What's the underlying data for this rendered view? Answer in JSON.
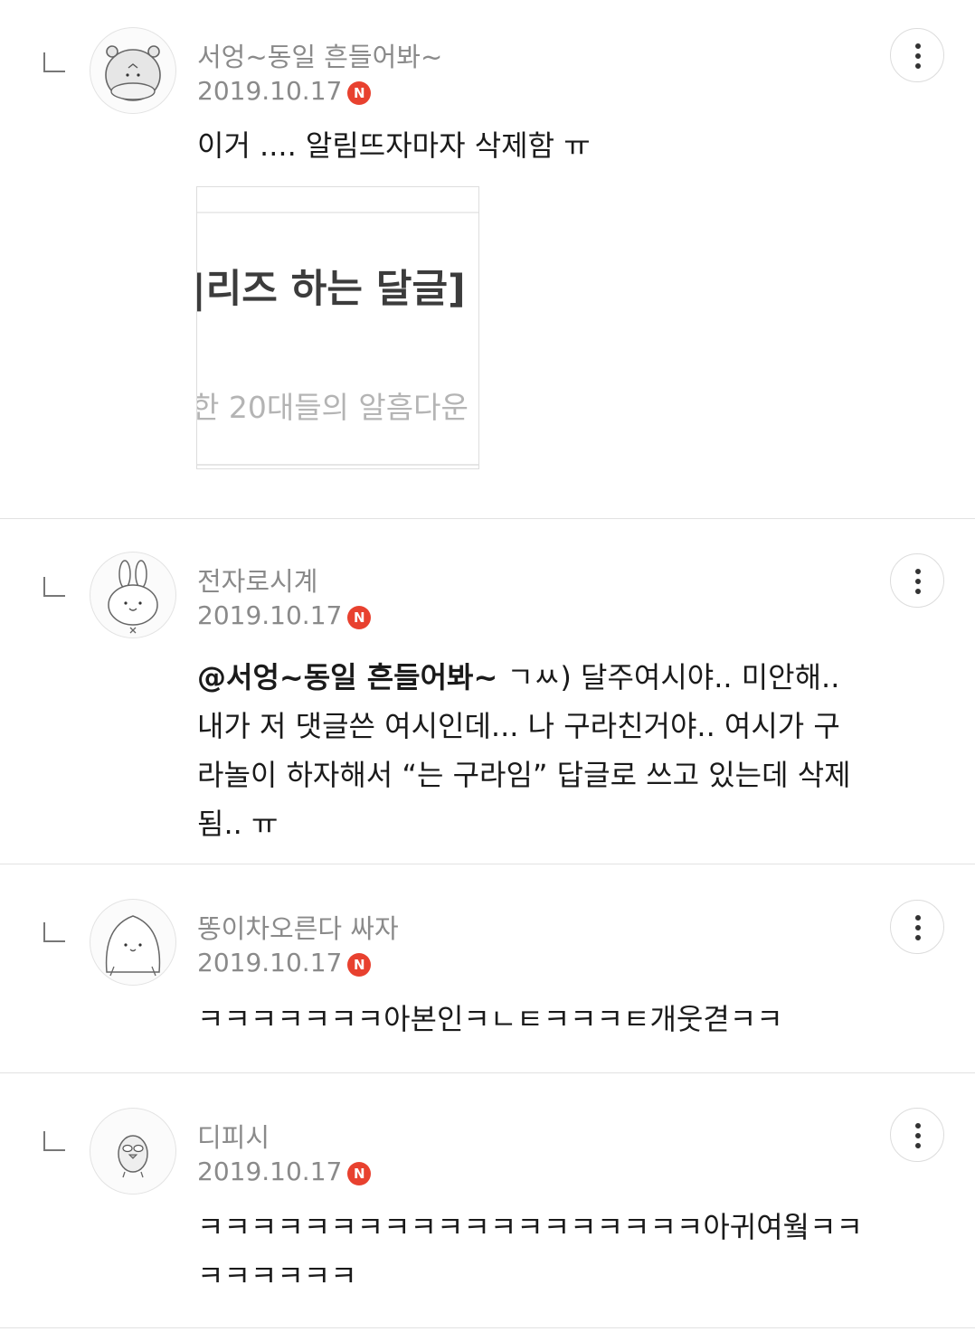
{
  "comments": [
    {
      "nickname": "서엉~동일 흔들어봐~",
      "date": "2019.10.17",
      "badge": "N",
      "mention": "",
      "text": "이거 .... 알림뜨자마자 삭제함 ㅠ",
      "avatar_icon": "hamster-avatar-icon",
      "image": {
        "title": "|리즈 하는 달글]",
        "subtitle": "한 20대들의 알흠다운"
      }
    },
    {
      "nickname": "전자로시계",
      "date": "2019.10.17",
      "badge": "N",
      "mention": "@서엉~동일 흔들어봐~",
      "text": " ㄱㅆ) 달주여시야.. 미안해.. 내가 저 댓글쓴 여시인데... 나 구라친거야.. 여시가 구라놀이 하자해서 “는 구라임” 답글로 쓰고 있는데 삭제됨.. ㅠ",
      "avatar_icon": "rabbit-avatar-icon"
    },
    {
      "nickname": "똥이차오른다 싸자",
      "date": "2019.10.17",
      "badge": "N",
      "mention": "",
      "text": "ㅋㅋㅋㅋㅋㅋㅋ아본인ㅋㄴㅌㅋㅋㅋㅌ개웃겯ㅋㅋ",
      "avatar_icon": "blob-avatar-icon"
    },
    {
      "nickname": "디피시",
      "date": "2019.10.17",
      "badge": "N",
      "mention": "",
      "text": "ㅋㅋㅋㅋㅋㅋㅋㅋㅋㅋㅋㅋㅋㅋㅋㅋㅋㅋㅋ아귀여웤ㅋㅋㅋㅋㅋㅋㅋㅋ",
      "avatar_icon": "duck-avatar-icon"
    }
  ],
  "colors": {
    "meta_text": "#8a8a8a",
    "new_badge": "#e8412f",
    "divider": "#e2e2e2"
  }
}
